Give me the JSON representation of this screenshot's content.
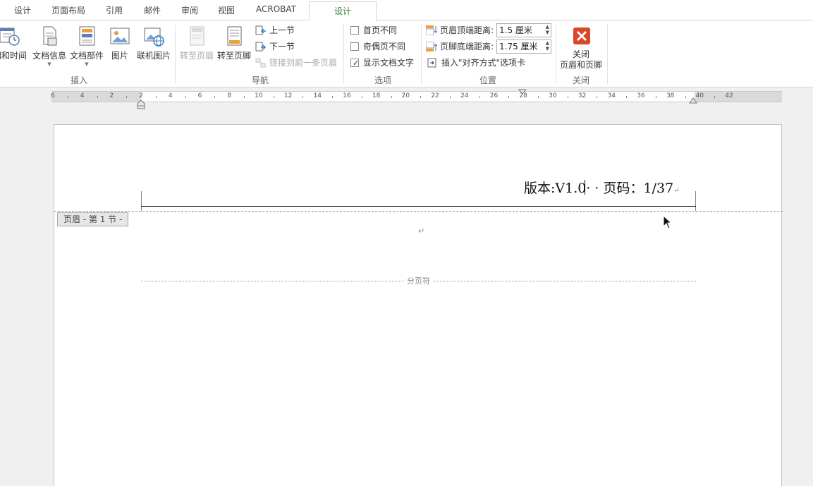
{
  "tabs": [
    {
      "label": "设计"
    },
    {
      "label": "页面布局"
    },
    {
      "label": "引用"
    },
    {
      "label": "邮件"
    },
    {
      "label": "审阅"
    },
    {
      "label": "视图"
    },
    {
      "label": "ACROBAT"
    },
    {
      "label": "设计",
      "active": true
    }
  ],
  "ribbon": {
    "insert": {
      "label": "插入",
      "date_time": "日期和时间",
      "doc_info": "文档信息",
      "doc_parts": "文档部件",
      "picture": "图片",
      "online_picture": "联机图片"
    },
    "nav": {
      "label": "导航",
      "goto_header": "转至页眉",
      "goto_footer": "转至页脚",
      "prev": "上一节",
      "next": "下一节",
      "link_prev": "链接到前一条页眉"
    },
    "options": {
      "label": "选项",
      "first_page": "首页不同",
      "odd_even": "奇偶页不同",
      "show_text": "显示文档文字",
      "show_text_checked": true
    },
    "position": {
      "label": "位置",
      "header_top": "页眉顶端距离:",
      "header_top_value": "1.5 厘米",
      "footer_bottom": "页脚底端距离:",
      "footer_bottom_value": "1.75 厘米",
      "insert_align_tab": "插入\"对齐方式\"选项卡"
    },
    "close": {
      "label": "关闭",
      "close_line1": "关闭",
      "close_line2": "页眉和页脚"
    }
  },
  "ruler": {
    "labels": [
      "6",
      "4",
      "2",
      "2",
      "4",
      "6",
      "8",
      "10",
      "12",
      "14",
      "16",
      "18",
      "20",
      "22",
      "24",
      "26",
      "28",
      "30",
      "32",
      "34",
      "36",
      "38",
      "40",
      "42"
    ]
  },
  "document": {
    "header_text_a": "版本:V1.",
    "header_text_b": "0· · 页码：1/37",
    "header_tag": "页眉 - 第 1 节 -",
    "page_break": "分页符",
    "paragraph_mark": "↵"
  },
  "colors": {
    "accent": "#2e7d32",
    "close_red": "#d9472b"
  }
}
